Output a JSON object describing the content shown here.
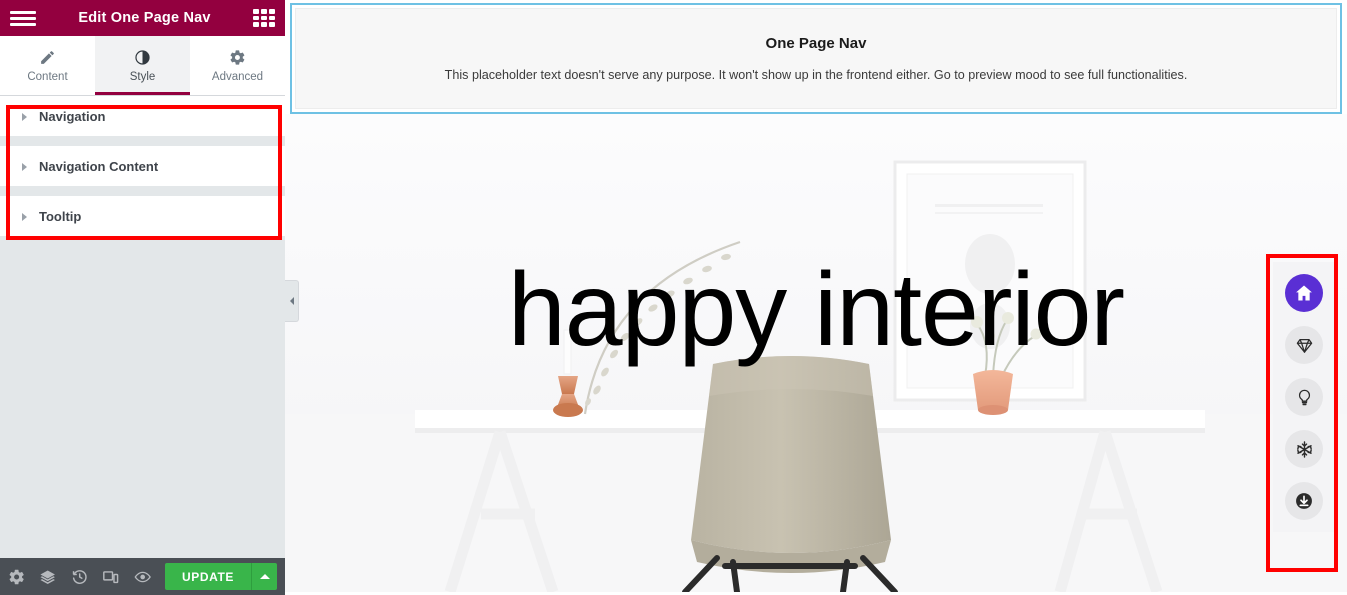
{
  "panel": {
    "header": {
      "menu_icon": "hamburger-icon",
      "title": "Edit One Page Nav",
      "grid_icon": "grid-apps-icon"
    },
    "tabs": [
      {
        "label": "Content",
        "icon": "pencil-icon",
        "active": false
      },
      {
        "label": "Style",
        "icon": "contrast-icon",
        "active": true
      },
      {
        "label": "Advanced",
        "icon": "gear-icon",
        "active": false
      }
    ],
    "sections": [
      {
        "label": "Navigation",
        "expanded": false
      },
      {
        "label": "Navigation Content",
        "expanded": false
      },
      {
        "label": "Tooltip",
        "expanded": false
      }
    ],
    "footer": {
      "icons": [
        "settings-gear-icon",
        "layers-navigator-icon",
        "history-icon",
        "responsive-mode-icon",
        "preview-eye-icon"
      ],
      "update_label": "UPDATE",
      "update_caret_icon": "caret-up-icon"
    },
    "collapse_handle_icon": "chevron-left-icon"
  },
  "canvas": {
    "widget": {
      "title": "One Page Nav",
      "text": "This placeholder text doesn't serve any purpose. It won't show up in the frontend either. Go to preview mood to see full functionalities."
    },
    "hero": {
      "caption": "happy interior"
    },
    "nav_dock": {
      "items": [
        {
          "icon": "home-icon",
          "active": true
        },
        {
          "icon": "diamond-gem-icon",
          "active": false
        },
        {
          "icon": "lightbulb-icon",
          "active": false
        },
        {
          "icon": "snowflake-icon",
          "active": false
        },
        {
          "icon": "download-arrow-circle-icon",
          "active": false
        }
      ]
    }
  },
  "colors": {
    "header_burgundy": "#93003f",
    "tab_active_underline": "#93003f",
    "update_green": "#39b54a",
    "footer_dark": "#4a4f55",
    "panel_bg": "#e3e7e9",
    "selection_blue": "#6ec1e4",
    "annotation_red": "#ff0000",
    "nav_active_purple": "#5a2fd4"
  }
}
